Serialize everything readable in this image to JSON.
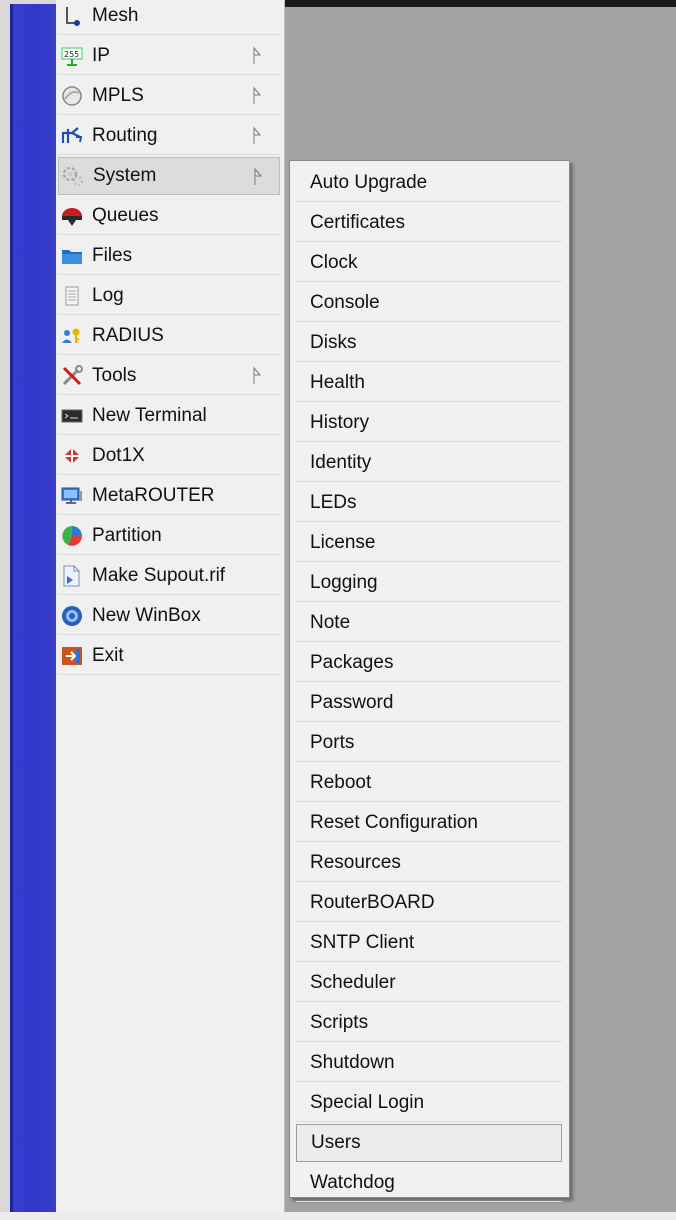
{
  "main_menu": {
    "items": [
      {
        "label": "Mesh",
        "icon": "mesh-icon",
        "has_submenu": false
      },
      {
        "label": "IP",
        "icon": "ip-icon",
        "has_submenu": true
      },
      {
        "label": "MPLS",
        "icon": "mpls-icon",
        "has_submenu": true
      },
      {
        "label": "Routing",
        "icon": "routing-icon",
        "has_submenu": true
      },
      {
        "label": "System",
        "icon": "system-gear-icon",
        "has_submenu": true,
        "active": true
      },
      {
        "label": "Queues",
        "icon": "queues-icon",
        "has_submenu": false
      },
      {
        "label": "Files",
        "icon": "folder-icon",
        "has_submenu": false
      },
      {
        "label": "Log",
        "icon": "log-document-icon",
        "has_submenu": false
      },
      {
        "label": "RADIUS",
        "icon": "radius-users-icon",
        "has_submenu": false
      },
      {
        "label": "Tools",
        "icon": "tools-icon",
        "has_submenu": true
      },
      {
        "label": "New Terminal",
        "icon": "terminal-icon",
        "has_submenu": false
      },
      {
        "label": "Dot1X",
        "icon": "dot1x-icon",
        "has_submenu": false
      },
      {
        "label": "MetaROUTER",
        "icon": "monitor-icon",
        "has_submenu": false
      },
      {
        "label": "Partition",
        "icon": "partition-pie-icon",
        "has_submenu": false
      },
      {
        "label": "Make Supout.rif",
        "icon": "supout-file-icon",
        "has_submenu": false
      },
      {
        "label": "New WinBox",
        "icon": "winbox-icon",
        "has_submenu": false
      },
      {
        "label": "Exit",
        "icon": "exit-icon",
        "has_submenu": false
      }
    ]
  },
  "submenu": {
    "items": [
      {
        "label": "Auto Upgrade"
      },
      {
        "label": "Certificates"
      },
      {
        "label": "Clock"
      },
      {
        "label": "Console"
      },
      {
        "label": "Disks"
      },
      {
        "label": "Health"
      },
      {
        "label": "History"
      },
      {
        "label": "Identity"
      },
      {
        "label": "LEDs"
      },
      {
        "label": "License"
      },
      {
        "label": "Logging"
      },
      {
        "label": "Note"
      },
      {
        "label": "Packages"
      },
      {
        "label": "Password"
      },
      {
        "label": "Ports"
      },
      {
        "label": "Reboot"
      },
      {
        "label": "Reset Configuration"
      },
      {
        "label": "Resources"
      },
      {
        "label": "RouterBOARD"
      },
      {
        "label": "SNTP Client"
      },
      {
        "label": "Scheduler"
      },
      {
        "label": "Scripts"
      },
      {
        "label": "Shutdown"
      },
      {
        "label": "Special Login"
      },
      {
        "label": "Users",
        "highlighted": true
      },
      {
        "label": "Watchdog"
      }
    ]
  },
  "colors": {
    "left_bar": "#3a3fd2",
    "menu_bg": "#f0f0f0",
    "workspace": "#a3a3a3",
    "active_bg": "#dcdcdc"
  }
}
